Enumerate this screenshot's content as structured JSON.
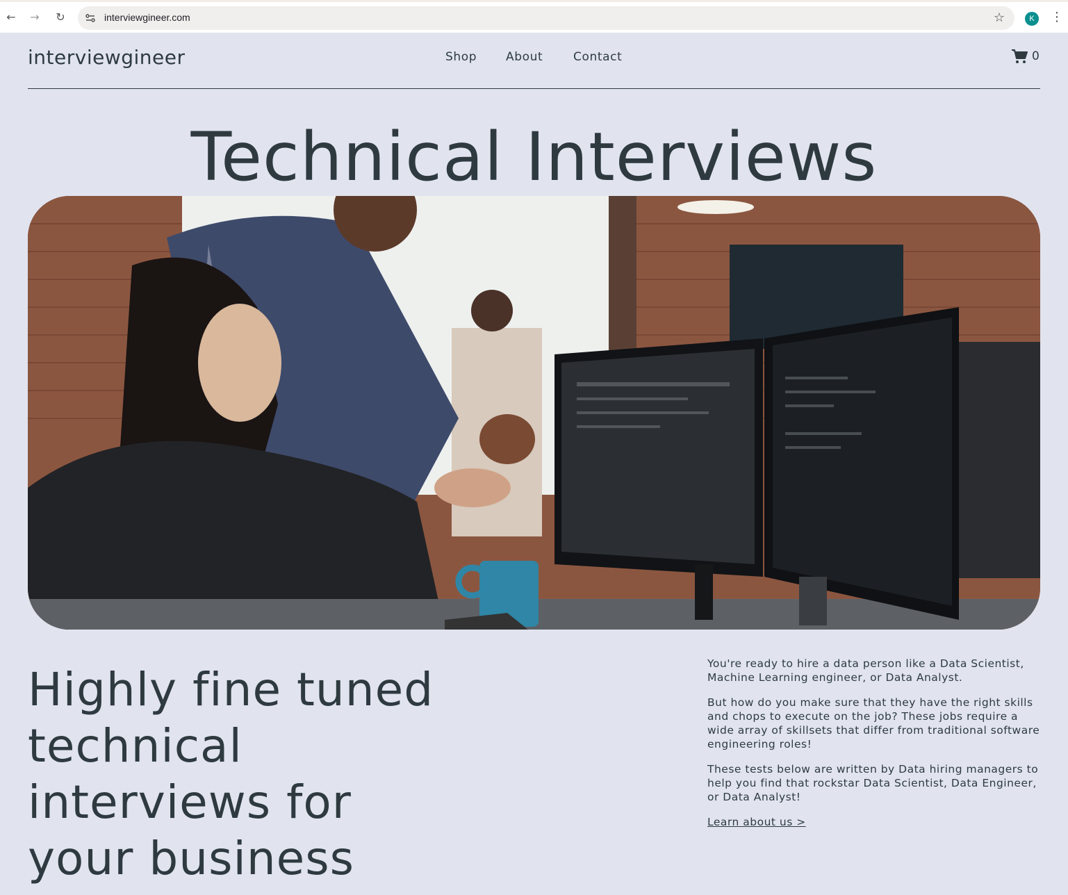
{
  "browser": {
    "url": "interviewgineer.com",
    "profile_initial": "K"
  },
  "site": {
    "logo": "interviewgineer",
    "nav": {
      "shop": "Shop",
      "about": "About",
      "contact": "Contact"
    },
    "cart_count": "0"
  },
  "hero": {
    "title": "Technical Interviews"
  },
  "intro": {
    "tagline": "Highly fine tuned technical interviews for your business",
    "paragraphs": [
      "You're ready to hire a data person like a Data Scientist, Machine Learning engineer, or Data Analyst.",
      "But how do you make sure that they have the right skills and chops to execute on the job? These jobs require a wide array of skillsets that differ from traditional software engineering roles!",
      "These tests below are written by Data hiring managers to help you find that rockstar Data Scientist, Data Engineer, or Data Analyst!"
    ],
    "learn_link": "Learn about us >"
  }
}
